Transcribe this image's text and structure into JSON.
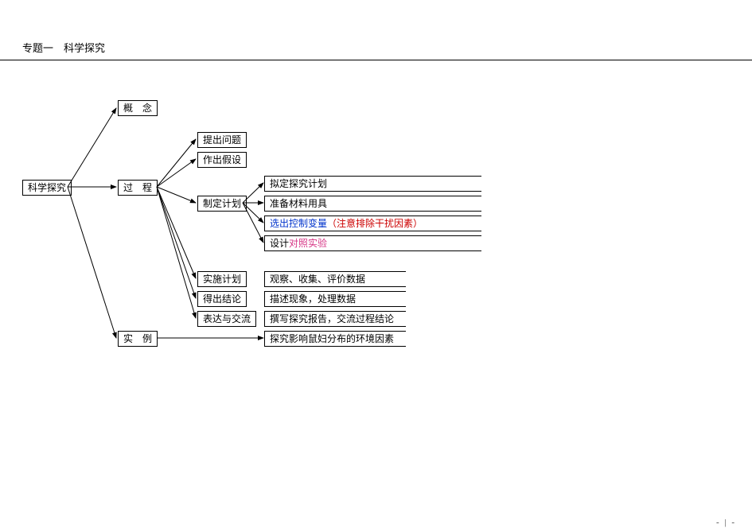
{
  "title": "专题一　科学探究",
  "root": "科学探究",
  "concept": "概　念",
  "process": "过　程",
  "example": "实　例",
  "process_children": {
    "question": "提出问题",
    "hypothesis": "作出假设",
    "plan": "制定计划",
    "implement": "实施计划",
    "conclusion": "得出结论",
    "express": "表达与交流"
  },
  "plan_children": {
    "draft": "拟定探究计划",
    "prepare": "准备材料用具",
    "control_var": {
      "a": "选出控制变量",
      "b": "（注意排除干扰因素）"
    },
    "design": {
      "a": "设计",
      "b": "对照实验"
    }
  },
  "implement_desc": "观察、收集、评价数据",
  "conclusion_desc": "描述现象，处理数据",
  "express_desc": "撰写探究报告，交流过程结论",
  "example_desc": "探究影响鼠妇分布的环境因素",
  "footer": "- | -"
}
